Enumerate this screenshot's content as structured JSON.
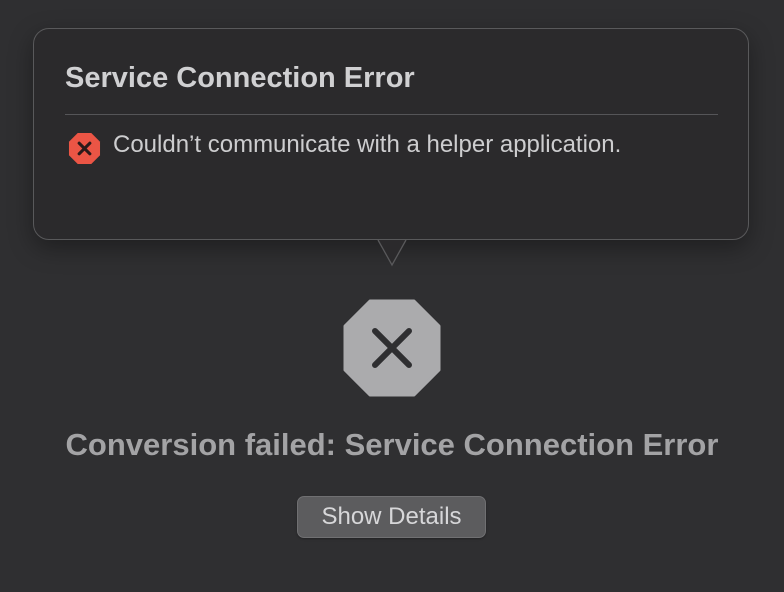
{
  "popover": {
    "title": "Service Connection Error",
    "message": "Couldn’t communicate with a helper application.",
    "icon": "error-x-icon",
    "icon_color": "#eb5545"
  },
  "main": {
    "icon": "stop-x-icon",
    "status": "Conversion failed: Service Connection Error",
    "details_button_label": "Show Details"
  },
  "colors": {
    "background": "#2f2f31",
    "popover_background": "#2b2a2c",
    "button_background": "#5c5c5e"
  }
}
